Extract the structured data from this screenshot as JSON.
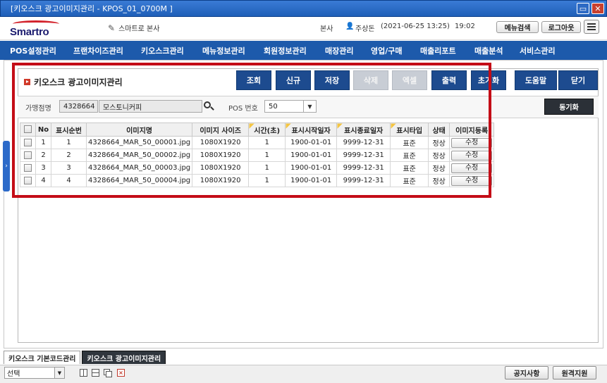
{
  "window": {
    "title": "[키오스크 광고이미지관리 - KPOS_01_0700M ]"
  },
  "header": {
    "logo_text": "Smartro",
    "store_name": "스마트로 본사",
    "branch": "본사",
    "user": "주상돈",
    "datetime": "(2021-06-25 13:25)",
    "clock": "19:02",
    "menu_search_label": "메뉴검색",
    "logout_label": "로그아웃"
  },
  "menu": [
    "POS설정관리",
    "프랜차이즈관리",
    "키오스크관리",
    "메뉴정보관리",
    "회원정보관리",
    "매장관리",
    "영업/구매",
    "매출리포트",
    "매출분석",
    "서비스관리"
  ],
  "page": {
    "title": "키오스크 광고이미지관리"
  },
  "toolbar": {
    "query": "조회",
    "new": "신규",
    "save": "저장",
    "delete": "삭제",
    "excel": "엑셀",
    "print": "출력",
    "reset": "초기화",
    "help": "도움말",
    "close": "닫기"
  },
  "search": {
    "store_label": "가맹점명",
    "store_code": "4328664",
    "store_name": "모스토니커피",
    "pos_label": "POS 번호",
    "pos_value": "50",
    "sync_label": "동기화"
  },
  "grid": {
    "columns": [
      "No",
      "표시순번",
      "이미지명",
      "이미지 사이즈",
      "시간(초)",
      "표시시작일자",
      "표시종료일자",
      "표시타입",
      "상태",
      "이미지등록"
    ],
    "rows": [
      {
        "no": "1",
        "order": "1",
        "name": "4328664_MAR_50_00001.jpg",
        "size": "1080X1920",
        "sec": "1",
        "start": "1900-01-01",
        "end": "9999-12-31",
        "type": "표준",
        "status": "정상",
        "action": "수정"
      },
      {
        "no": "2",
        "order": "2",
        "name": "4328664_MAR_50_00002.jpg",
        "size": "1080X1920",
        "sec": "1",
        "start": "1900-01-01",
        "end": "9999-12-31",
        "type": "표준",
        "status": "정상",
        "action": "수정"
      },
      {
        "no": "3",
        "order": "3",
        "name": "4328664_MAR_50_00003.jpg",
        "size": "1080X1920",
        "sec": "1",
        "start": "1900-01-01",
        "end": "9999-12-31",
        "type": "표준",
        "status": "정상",
        "action": "수정"
      },
      {
        "no": "4",
        "order": "4",
        "name": "4328664_MAR_50_00004.jpg",
        "size": "1080X1920",
        "sec": "1",
        "start": "1900-01-01",
        "end": "9999-12-31",
        "type": "표준",
        "status": "정상",
        "action": "수정"
      }
    ]
  },
  "tabs": {
    "tab1": "키오스크 기본코드관리",
    "tab2": "키오스크 광고이미지관리"
  },
  "status": {
    "select_value": "선택",
    "notice_label": "공지사항",
    "remote_label": "원격지원"
  },
  "colors": {
    "title_bar": "#1f5fb8",
    "menu_bar": "#1d5aab",
    "toolbar_button": "#1d4b8f",
    "highlight_box": "#c40d17"
  }
}
